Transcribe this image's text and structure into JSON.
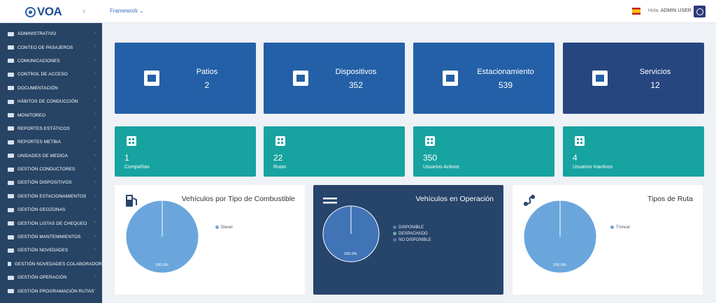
{
  "header": {
    "logo_text": "VOA",
    "menu_label": "Framework",
    "greeting": "Hola,",
    "user_name": "ADMIN USER"
  },
  "sidebar": {
    "items": [
      {
        "label": "ADMINISTRATIVO",
        "icon": "building-icon"
      },
      {
        "label": "CONTEO DE PASAJEROS",
        "icon": "bus-icon"
      },
      {
        "label": "COMUNICACIONES",
        "icon": "microphone-icon"
      },
      {
        "label": "CONTROL DE ACCESO",
        "icon": "key-icon"
      },
      {
        "label": "DOCUMENTACIÓN",
        "icon": "document-icon"
      },
      {
        "label": "HÁBITOS DE CONDUCCIÓN",
        "icon": "hand-icon"
      },
      {
        "label": "MONITOREO",
        "icon": "monitor-icon"
      },
      {
        "label": "REPORTES ESTÁTICOS",
        "icon": "chart-icon"
      },
      {
        "label": "REPORTES METBIA",
        "icon": "globe-icon"
      },
      {
        "label": "UNIDADES DE MEDIDA",
        "icon": "sitemap-icon"
      },
      {
        "label": "GESTIÓN CONDUCTORES",
        "icon": "users-icon"
      },
      {
        "label": "GESTIÓN DISPOSITIVOS",
        "icon": "list-icon"
      },
      {
        "label": "GESTIÓN ESTACIONAMIENTOS",
        "icon": "parking-icon"
      },
      {
        "label": "GESTIÓN GEOZONAS",
        "icon": "map-icon"
      },
      {
        "label": "GESTIÓN LISTAS DE CHEQUEO",
        "icon": "checklist-icon"
      },
      {
        "label": "GESTIÓN MANTENIMIENTOS",
        "icon": "gears-icon"
      },
      {
        "label": "GESTIÓN NOVEDADES",
        "icon": "hourglass-icon"
      },
      {
        "label": "GESTIÓN NOVEDADES COLABORADOR",
        "icon": "user-gear-icon"
      },
      {
        "label": "GESTIÓN OPERACIÓN",
        "icon": "truck-icon"
      },
      {
        "label": "GESTIÓN PROGRAMACIÓN RUTAS",
        "icon": "route-clock-icon"
      }
    ]
  },
  "stats_top": [
    {
      "title": "Patios",
      "value": "2",
      "icon": "map-icon"
    },
    {
      "title": "Dispositivos",
      "value": "352",
      "icon": "monitor-icon"
    },
    {
      "title": "Estacionamiento",
      "value": "539",
      "icon": "parking-icon"
    },
    {
      "title": "Servicios",
      "value": "12",
      "icon": "server-icon"
    }
  ],
  "stats_mid": [
    {
      "value": "1",
      "label": "Compañías",
      "icon": "building-icon"
    },
    {
      "value": "22",
      "label": "Rutas",
      "icon": "route-icon"
    },
    {
      "value": "350",
      "label": "Usuarios Activos",
      "icon": "users-icon"
    },
    {
      "value": "4",
      "label": "Usuarios Inactivos",
      "icon": "users-slash-icon"
    }
  ],
  "panels": [
    {
      "title": "Vehículos por Tipo de Combustible",
      "icon": "gas-pump-icon",
      "legend": [
        {
          "label": "Diesel",
          "color": "#6aa6dc"
        }
      ],
      "slice_label": "100.0%",
      "pie_color": "#6aa6dc"
    },
    {
      "title": "Vehículos en Operación",
      "icon": "bars-icon",
      "legend": [
        {
          "label": "DISPONIBLE",
          "color": "#4a7ec4"
        },
        {
          "label": "DESPACHADO",
          "color": "#69b0a7"
        },
        {
          "label": "NO DISPONIBLE",
          "color": "#5c6fb3"
        }
      ],
      "slice_label": "100.0%",
      "pie_color": "#4173b7"
    },
    {
      "title": "Tipos de Ruta",
      "icon": "route-icon",
      "legend": [
        {
          "label": "Troncal",
          "color": "#6aa6dc"
        }
      ],
      "slice_label": "100.0%",
      "pie_color": "#6aa6dc"
    }
  ],
  "colors": {
    "sidebar_bg": "#274465",
    "top_card_blue": "#2460a7",
    "top_card_dark": "#264680",
    "teal_card": "#17a3a0",
    "dark_panel": "#27446a"
  }
}
